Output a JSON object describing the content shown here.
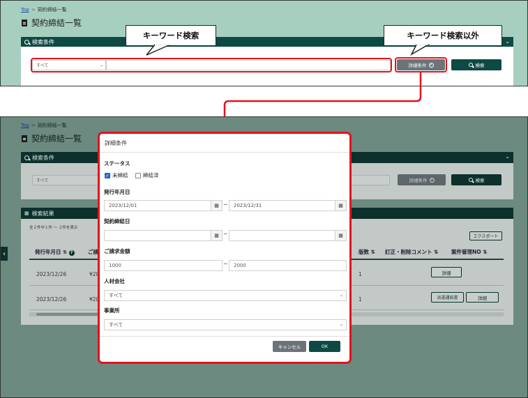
{
  "colors": {
    "accent": "#0e4a44",
    "highlight": "#e0131d",
    "top_bg": "#a7cfc0",
    "overlay": "#6c8a80"
  },
  "top": {
    "breadcrumb": {
      "home": "Top",
      "separator": ">",
      "current": "契約締結一覧"
    },
    "page_title": "契約締結一覧",
    "search_header": "検索条件",
    "category_select": "すべて",
    "keyword_value": "",
    "detail_button": "詳細条件",
    "search_button": "検索",
    "callout_keyword": "キーワード検索",
    "callout_other": "キーワード検索以外"
  },
  "bottom": {
    "breadcrumb": {
      "home": "Top",
      "separator": ">",
      "current": "契約締結一覧"
    },
    "page_title": "契約締結一覧",
    "search_header": "検索条件",
    "category_select": "すべて",
    "detail_button": "詳細条件",
    "search_button": "検索",
    "results_header": "検索結果",
    "result_count": "全２件中１件 ～ ２件を表示",
    "export_button": "エクスポート",
    "columns": [
      "発行年月日",
      "ご請",
      "版数",
      "訂正・削除コメント",
      "案件管理NO"
    ],
    "rows": [
      {
        "date": "2023/12/26",
        "amount": "¥20",
        "version": "1",
        "buttons": [
          "詳細"
        ]
      },
      {
        "date": "2023/12/26",
        "amount": "¥20",
        "version": "1",
        "buttons": [
          "派遣通知書",
          "詳細"
        ]
      }
    ]
  },
  "modal": {
    "title": "詳細条件",
    "status_label": "ステータス",
    "status_options": [
      {
        "label": "未締結",
        "checked": true
      },
      {
        "label": "締結済",
        "checked": false
      }
    ],
    "issue_date_label": "発行年月日",
    "issue_date_from": "2023/12/01",
    "issue_date_to": "2023/12/31",
    "contract_date_label": "契約締結日",
    "contract_date_from": "",
    "contract_date_to": "",
    "amount_label": "ご請求金額",
    "amount_from": "1000",
    "amount_to": "2000",
    "range_sep": "~",
    "staffing_label": "人材会社",
    "staffing_value": "すべて",
    "office_label": "事業所",
    "office_value": "すべて",
    "cancel_button": "キャンセル",
    "ok_button": "OK"
  },
  "icons": [
    "document-icon",
    "search-icon",
    "chevron-down-icon",
    "plus-circle-icon",
    "calendar-icon",
    "sort-icon",
    "help-icon",
    "chevron-left-icon",
    "table-icon",
    "arrow-down-icon"
  ]
}
